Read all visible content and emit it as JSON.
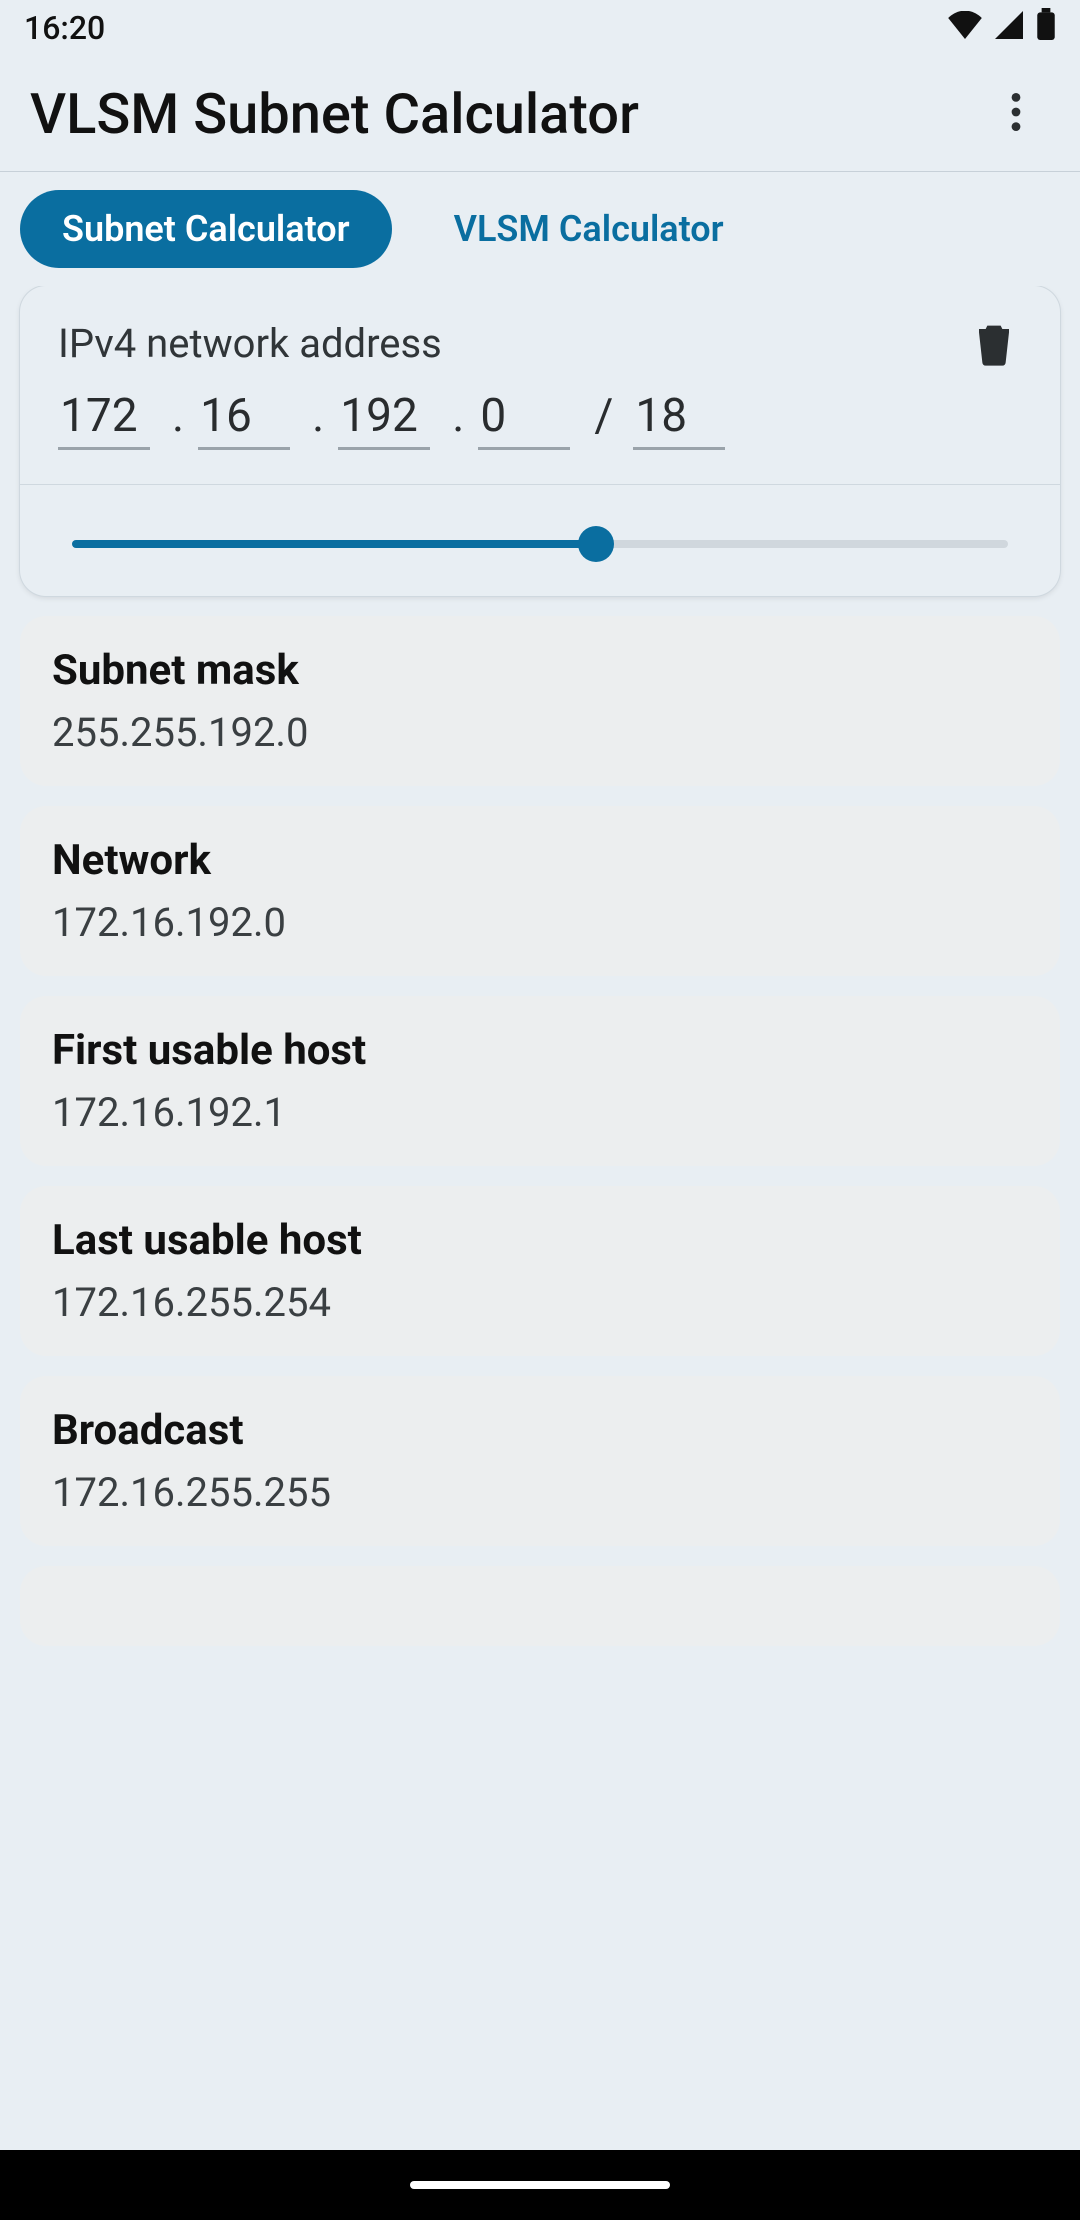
{
  "status": {
    "time": "16:20"
  },
  "app": {
    "title": "VLSM Subnet Calculator"
  },
  "tabs": {
    "subnet": "Subnet Calculator",
    "vlsm": "VLSM Calculator"
  },
  "input": {
    "label": "IPv4 network address",
    "octet1": "172",
    "octet2": "16",
    "octet3": "192",
    "octet4": "0",
    "prefix": "18",
    "slider_min": 0,
    "slider_max": 32,
    "slider_value": 18
  },
  "results": [
    {
      "title": "Subnet mask",
      "value": "255.255.192.0"
    },
    {
      "title": "Network",
      "value": "172.16.192.0"
    },
    {
      "title": "First usable host",
      "value": "172.16.192.1"
    },
    {
      "title": "Last usable host",
      "value": "172.16.255.254"
    },
    {
      "title": "Broadcast",
      "value": "172.16.255.255"
    }
  ]
}
